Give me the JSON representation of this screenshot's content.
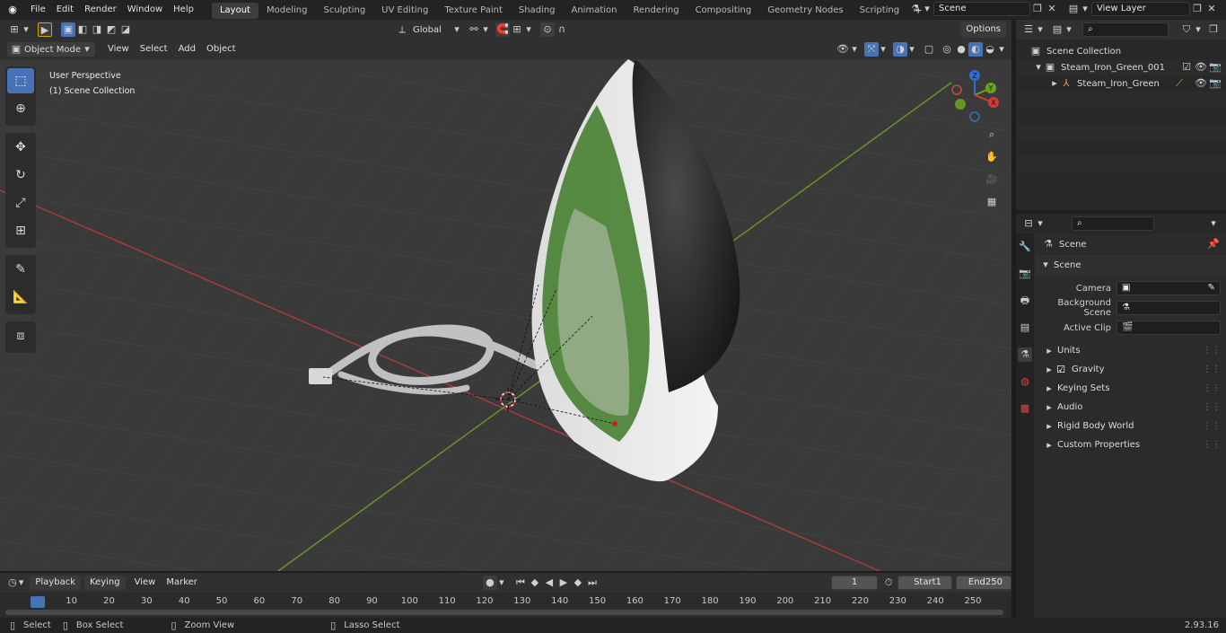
{
  "top_menu": [
    "File",
    "Edit",
    "Render",
    "Window",
    "Help"
  ],
  "workspaces": [
    {
      "label": "Layout",
      "active": true
    },
    {
      "label": "Modeling"
    },
    {
      "label": "Sculpting"
    },
    {
      "label": "UV Editing"
    },
    {
      "label": "Texture Paint"
    },
    {
      "label": "Shading"
    },
    {
      "label": "Animation"
    },
    {
      "label": "Rendering"
    },
    {
      "label": "Compositing"
    },
    {
      "label": "Geometry Nodes"
    },
    {
      "label": "Scripting"
    }
  ],
  "add_workspace": "+",
  "scene_name": "Scene",
  "view_layer": "View Layer",
  "viewport": {
    "mode": "Object Mode",
    "menus": [
      "View",
      "Select",
      "Add",
      "Object"
    ],
    "transform_orientation": "Global",
    "options_label": "Options",
    "overlay_line1": "User Perspective",
    "overlay_line2": "(1) Scene Collection",
    "gizmo_axes": {
      "x": "X",
      "y": "Y",
      "z": "Z"
    }
  },
  "outliner": {
    "root": "Scene Collection",
    "items": [
      {
        "label": "Steam_Iron_Green_001",
        "level": 1
      },
      {
        "label": "Steam_Iron_Green",
        "level": 2
      }
    ]
  },
  "properties": {
    "header": "Scene",
    "section": "Scene",
    "fields": [
      {
        "label": "Camera",
        "value": ""
      },
      {
        "label": "Background Scene",
        "value": ""
      },
      {
        "label": "Active Clip",
        "value": ""
      }
    ],
    "subpanels": [
      {
        "label": "Units",
        "checkbox": false
      },
      {
        "label": "Gravity",
        "checkbox": true
      },
      {
        "label": "Keying Sets",
        "checkbox": false
      },
      {
        "label": "Audio",
        "checkbox": false
      },
      {
        "label": "Rigid Body World",
        "checkbox": false
      },
      {
        "label": "Custom Properties",
        "checkbox": false
      }
    ]
  },
  "timeline": {
    "menus": [
      "Playback",
      "Keying",
      "View",
      "Marker"
    ],
    "current_frame": "1",
    "start_label": "Start",
    "start": "1",
    "end_label": "End",
    "end": "250",
    "ticks": [
      "1",
      "10",
      "20",
      "30",
      "40",
      "50",
      "60",
      "70",
      "80",
      "90",
      "100",
      "110",
      "120",
      "130",
      "140",
      "150",
      "160",
      "170",
      "180",
      "190",
      "200",
      "210",
      "220",
      "230",
      "240",
      "250"
    ]
  },
  "statusbar": {
    "items": [
      "Select",
      "Box Select",
      "Zoom View",
      "Lasso Select"
    ],
    "version": "2.93.16"
  },
  "colors": {
    "accent": "#4772b3",
    "axis_x": "#b03a3a",
    "axis_y": "#6a9a1f",
    "iron_green": "#3d7a26"
  }
}
